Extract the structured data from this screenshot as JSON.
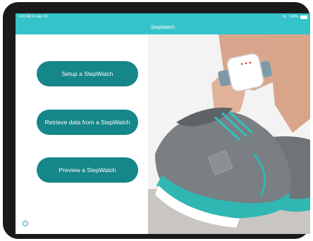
{
  "status_bar": {
    "time": "9:43 AM",
    "date": "Fri Apr 16",
    "battery": "100%"
  },
  "nav": {
    "title": "StepWatch"
  },
  "actions": {
    "setup_label": "Setup a StepWatch",
    "retrieve_label": "Retrieve data from a StepWatch",
    "preview_label": "Preview a StepWatch"
  },
  "icons": {
    "info": "info-icon",
    "wifi": "wifi-icon",
    "battery": "battery-icon"
  },
  "colors": {
    "accent": "#33c3c9",
    "button": "#15868a"
  }
}
